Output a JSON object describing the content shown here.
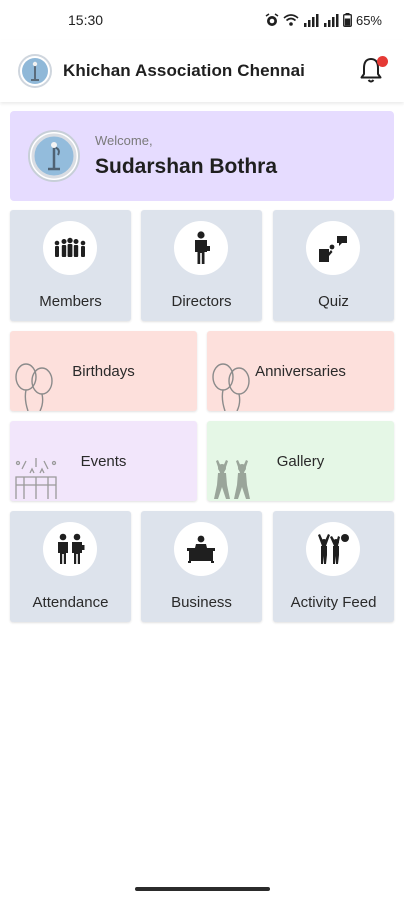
{
  "status_bar": {
    "time": "15:30",
    "battery": "65%"
  },
  "app_bar": {
    "title": "Khichan Association Chennai",
    "notification_dot": true
  },
  "welcome": {
    "label": "Welcome,",
    "name": "Sudarshan Bothra"
  },
  "tiles": {
    "members": {
      "label": "Members",
      "icon": "group-icon",
      "bg": "#dde3ec"
    },
    "directors": {
      "label": "Directors",
      "icon": "person-icon",
      "bg": "#dde3ec"
    },
    "quiz": {
      "label": "Quiz",
      "icon": "quiz-icon",
      "bg": "#dde3ec"
    },
    "birthdays": {
      "label": "Birthdays",
      "icon": "balloons-icon",
      "bg": "#fde0dc"
    },
    "anniversaries": {
      "label": "Anniversaries",
      "icon": "balloons-icon",
      "bg": "#fde0dc"
    },
    "events": {
      "label": "Events",
      "icon": "celebration-icon",
      "bg": "#f2e6fb"
    },
    "gallery": {
      "label": "Gallery",
      "icon": "people-cheering-icon",
      "bg": "#e5f7e6"
    },
    "attendance": {
      "label": "Attendance",
      "icon": "two-people-icon",
      "bg": "#dde3ec"
    },
    "business": {
      "label": "Business",
      "icon": "desk-person-icon",
      "bg": "#dde3ec"
    },
    "activity_feed": {
      "label": "Activity Feed",
      "icon": "cheering-group-icon",
      "bg": "#dde3ec"
    }
  },
  "colors": {
    "welcome_bg": "#e6dcff",
    "tile_blue": "#dde3ec",
    "tile_pink": "#fde0dc",
    "tile_purple": "#f2e6fb",
    "tile_green": "#e5f7e6",
    "badge_red": "#e53935"
  }
}
